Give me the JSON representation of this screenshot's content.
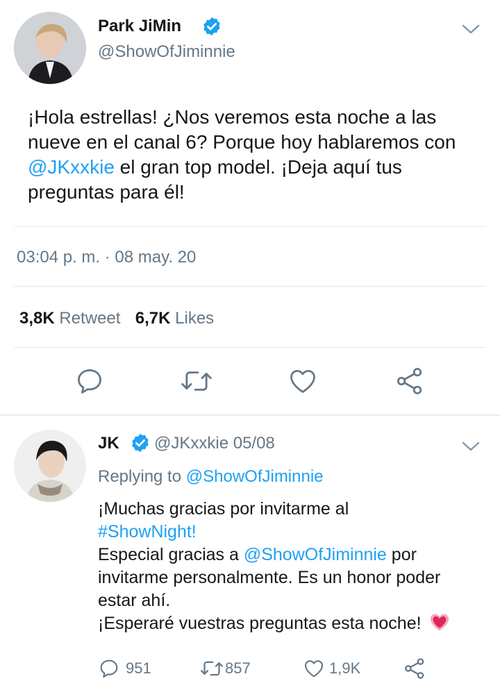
{
  "main_tweet": {
    "display_name": "Park JiMin",
    "handle": "@ShowOfJiminnie",
    "text_part1": "¡Hola estrellas! ¿Nos veremos esta noche a las nueve en el canal 6? Porque hoy hablaremos con ",
    "mention": "@JKxxkie",
    "text_part2": " el gran top model. ¡Deja aquí tus preguntas para él!",
    "timestamp": "03:04 p. m. · 08 may. 20",
    "retweets_count": "3,8K",
    "retweets_label": "Retweet",
    "likes_count": "6,7K",
    "likes_label": "Likes"
  },
  "reply_tweet": {
    "display_name": "JK",
    "handle_date": "@JKxxkie 05/08",
    "replying_prefix": "Replying to ",
    "replying_to": "@ShowOfJiminnie",
    "line1": "¡Muchas gracias por invitarme al",
    "hashtag": "#ShowNight!",
    "line3_prefix": "Especial gracias a ",
    "line3_mention": "@ShowOfJiminnie",
    "line3_suffix": " por",
    "line4": "invitarme personalmente. Es un honor poder",
    "line5": "estar ahí.",
    "line6": "¡Esperaré vuestras preguntas esta noche!",
    "replies": "951",
    "retweets": "857",
    "likes": "1,9K"
  },
  "colors": {
    "accent": "#1da1f2",
    "secondary_text": "#657786",
    "divider": "#e1e8ed",
    "heart_emoji": "#e0245e"
  }
}
